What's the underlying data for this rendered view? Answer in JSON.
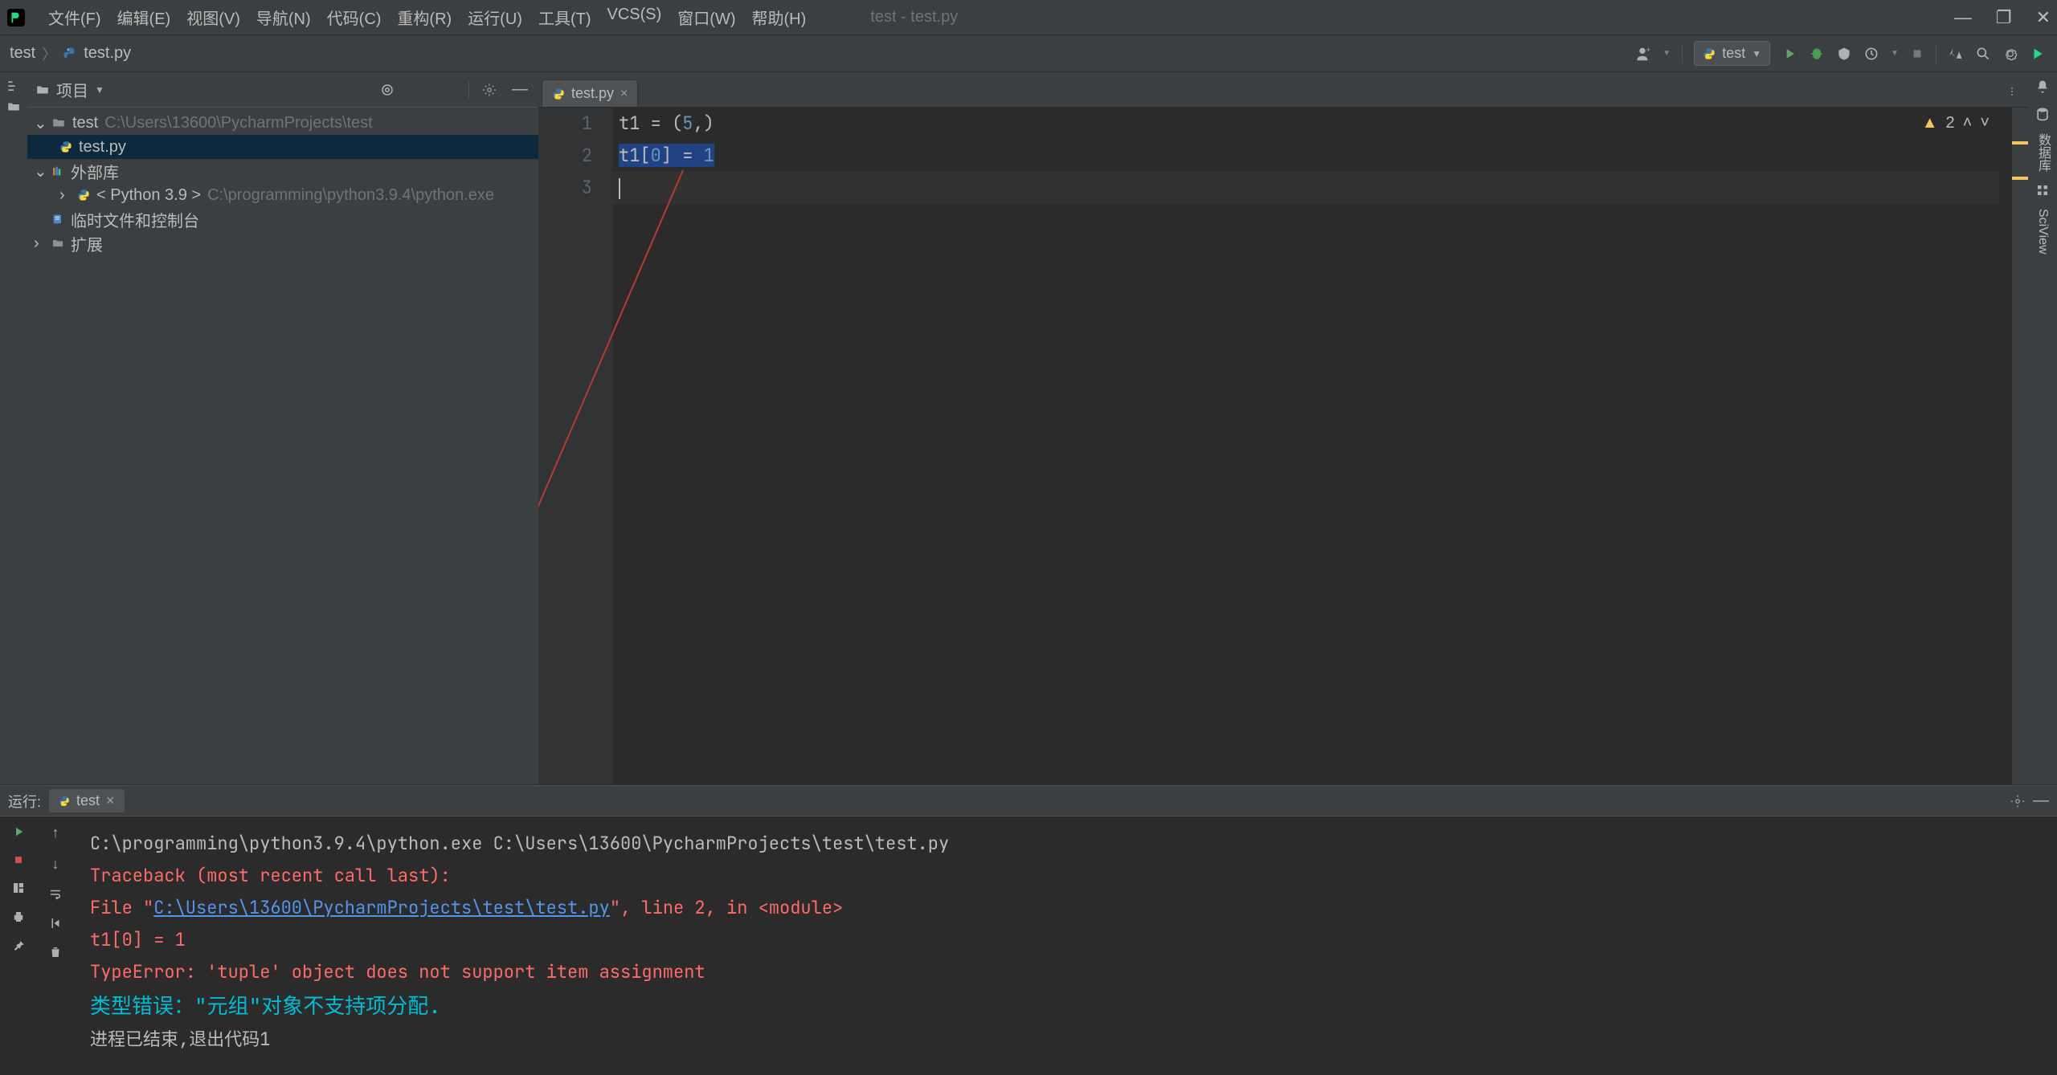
{
  "menu": [
    "文件(F)",
    "编辑(E)",
    "视图(V)",
    "导航(N)",
    "代码(C)",
    "重构(R)",
    "运行(U)",
    "工具(T)",
    "VCS(S)",
    "窗口(W)",
    "帮助(H)"
  ],
  "window_title": "test - test.py",
  "breadcrumb": {
    "project": "test",
    "file": "test.py"
  },
  "run_config": {
    "label": "test"
  },
  "project_panel": {
    "title": "项目",
    "tree": {
      "root": {
        "name": "test",
        "path": "C:\\Users\\13600\\PycharmProjects\\test"
      },
      "file": "test.py",
      "external": "外部库",
      "python_env": {
        "label": "< Python 3.9 >",
        "path": "C:\\programming\\python3.9.4\\python.exe"
      },
      "scratches": "临时文件和控制台",
      "extensions": "扩展"
    }
  },
  "editor": {
    "tab": "test.py",
    "lines": [
      "t1 = (5,)",
      "t1[0] = 1",
      ""
    ],
    "line_numbers": [
      "1",
      "2",
      "3"
    ],
    "warnings": "2"
  },
  "right_tabs": {
    "notifications": "通知",
    "db": "数据库",
    "sciview": "SciView"
  },
  "run": {
    "label": "运行:",
    "tab": "test",
    "lines": {
      "cmd": "C:\\programming\\python3.9.4\\python.exe C:\\Users\\13600\\PycharmProjects\\test\\test.py",
      "traceback": "Traceback (most recent call last):",
      "file_prefix": "  File \"",
      "file_link": "C:\\Users\\13600\\PycharmProjects\\test\\test.py",
      "file_suffix": "\", line 2, in <module>",
      "code": "    t1[0] = 1",
      "error": "TypeError: 'tuple' object does not support item assignment",
      "cn": "类型错误：\"元组\"对象不支持项分配.",
      "exit": "进程已结束,退出代码1"
    }
  }
}
